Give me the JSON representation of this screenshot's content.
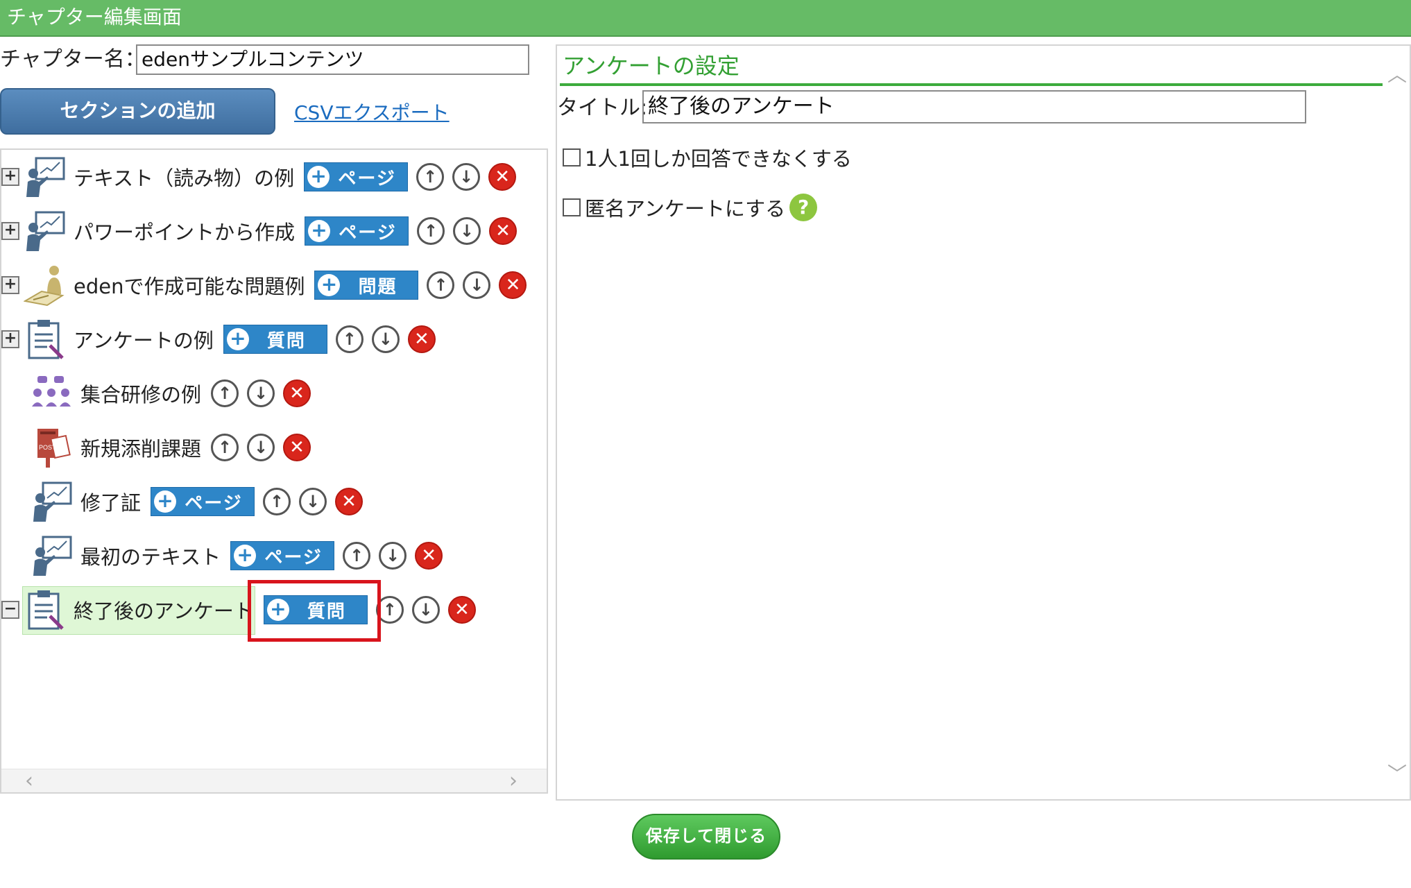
{
  "window": {
    "title": "チャプター編集画面"
  },
  "chapter": {
    "name_label": "チャプター名：",
    "name_value": "edenサンプルコンテンツ",
    "add_section_label": "セクションの追加",
    "csv_export_label": "CSVエクスポート"
  },
  "tree": {
    "nodes": [
      {
        "label": "テキスト（読み物）の例",
        "icon": "presenter-icon",
        "expander": "+",
        "add_label": "ページ"
      },
      {
        "label": "パワーポイントから作成",
        "icon": "presenter-icon",
        "expander": "+",
        "add_label": "ページ"
      },
      {
        "label": "edenで作成可能な問題例",
        "icon": "exam-person-icon",
        "expander": "+",
        "add_label": "問題"
      },
      {
        "label": "アンケートの例",
        "icon": "clipboard-icon",
        "expander": "+",
        "add_label": "質問"
      },
      {
        "label": "集合研修の例",
        "icon": "group-training-icon"
      },
      {
        "label": "新規添削課題",
        "icon": "postbox-icon"
      },
      {
        "label": "修了証",
        "icon": "presenter-icon",
        "add_label": "ページ"
      },
      {
        "label": "最初のテキスト",
        "icon": "presenter-icon",
        "add_label": "ページ"
      },
      {
        "label": "終了後のアンケート",
        "icon": "clipboard-icon",
        "expander": "−",
        "add_label": "質問",
        "selected": true
      }
    ]
  },
  "settings": {
    "heading": "アンケートの設定",
    "title_label": "タイトル:",
    "title_value": "終了後のアンケート",
    "option_once": "1人1回しか回答できなくする",
    "option_anonymous": "匿名アンケートにする"
  },
  "footer": {
    "save_label": "保存して閉じる"
  },
  "colors": {
    "titlebar": "#66bb66",
    "accent_blue": "#2e86c8",
    "heading_green": "#33a033",
    "delete_red": "#d9261c",
    "highlight": "#d8141c"
  }
}
